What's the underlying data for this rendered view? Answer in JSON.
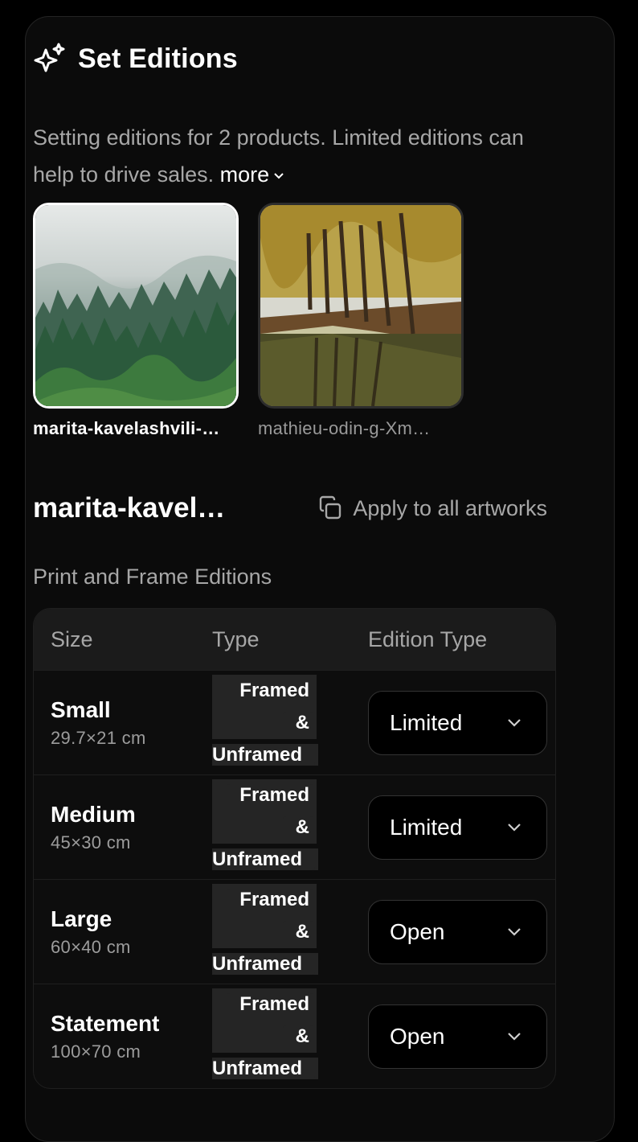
{
  "header": {
    "icon": "sparkle-icon",
    "title": "Set Editions"
  },
  "description": {
    "text": "Setting editions for 2 products. Limited editions can help to drive sales.",
    "more_label": "more"
  },
  "products": [
    {
      "name": "marita-kavelashvili-…",
      "selected": true,
      "image": "misty-forest"
    },
    {
      "name": "mathieu-odin-g-Xm…",
      "selected": false,
      "image": "autumn-trees-canal"
    }
  ],
  "artwork": {
    "title": "marita-kavel…",
    "apply_label": "Apply to all artworks",
    "apply_icon": "copy-icon"
  },
  "section_label": "Print and Frame Editions",
  "table": {
    "headers": {
      "size": "Size",
      "type": "Type",
      "edition": "Edition Type"
    },
    "rows": [
      {
        "size": "Small",
        "dims": "29.7×21 cm",
        "type_line1": "Framed &",
        "type_line2": "Unframed",
        "edition": "Limited"
      },
      {
        "size": "Medium",
        "dims": "45×30 cm",
        "type_line1": "Framed &",
        "type_line2": "Unframed",
        "edition": "Limited"
      },
      {
        "size": "Large",
        "dims": "60×40 cm",
        "type_line1": "Framed &",
        "type_line2": "Unframed",
        "edition": "Open"
      },
      {
        "size": "Statement",
        "dims": "100×70 cm",
        "type_line1": "Framed &",
        "type_line2": "Unframed",
        "edition": "Open"
      }
    ]
  }
}
